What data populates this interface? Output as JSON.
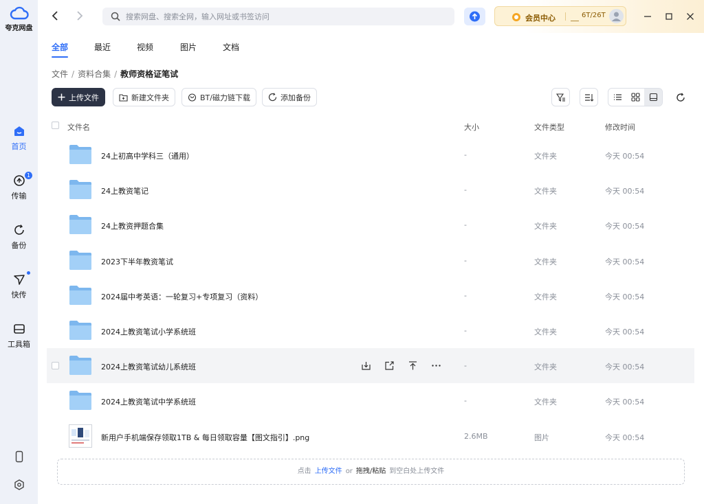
{
  "app": {
    "name": "夸克网盘"
  },
  "sidebar": {
    "items": [
      {
        "label": "首页",
        "icon": "home-icon",
        "active": true
      },
      {
        "label": "传输",
        "icon": "transfer-icon",
        "badge": "1"
      },
      {
        "label": "备份",
        "icon": "backup-icon"
      },
      {
        "label": "快传",
        "icon": "quick-send-icon",
        "dot": true
      },
      {
        "label": "工具箱",
        "icon": "toolbox-icon"
      }
    ],
    "bottom_icons": [
      "phone-icon",
      "settings-icon"
    ]
  },
  "topbar": {
    "search_placeholder": "搜索网盘、搜索全网，输入网址或书签访问",
    "vip_label": "会员中心",
    "quota": "6T/26T"
  },
  "tabs": [
    {
      "label": "全部",
      "active": true
    },
    {
      "label": "最近"
    },
    {
      "label": "视频"
    },
    {
      "label": "图片"
    },
    {
      "label": "文档"
    }
  ],
  "breadcrumb": {
    "items": [
      "文件",
      "资料合集"
    ],
    "current": "教师资格证笔试"
  },
  "toolbar": {
    "upload": "上传文件",
    "new_folder": "新建文件夹",
    "bt": "BT/磁力链下载",
    "backup": "添加备份"
  },
  "table": {
    "headers": {
      "name": "文件名",
      "size": "大小",
      "type": "文件类型",
      "modified": "修改时间"
    },
    "rows": [
      {
        "name": "24上初高中学科三（通用）",
        "size": "-",
        "type": "文件夹",
        "modified": "今天 00:54",
        "kind": "folder"
      },
      {
        "name": "24上教资笔记",
        "size": "-",
        "type": "文件夹",
        "modified": "今天 00:54",
        "kind": "folder"
      },
      {
        "name": "24上教资押题合集",
        "size": "-",
        "type": "文件夹",
        "modified": "今天 00:54",
        "kind": "folder"
      },
      {
        "name": "2023下半年教资笔试",
        "size": "-",
        "type": "文件夹",
        "modified": "今天 00:54",
        "kind": "folder"
      },
      {
        "name": "2024届中考英语：一轮复习+专项复习（资料）",
        "size": "-",
        "type": "文件夹",
        "modified": "今天 00:54",
        "kind": "folder"
      },
      {
        "name": "2024上教资笔试小学系统班",
        "size": "-",
        "type": "文件夹",
        "modified": "今天 00:54",
        "kind": "folder"
      },
      {
        "name": "2024上教资笔试幼儿系统班",
        "size": "-",
        "type": "文件夹",
        "modified": "今天 00:54",
        "kind": "folder",
        "hover": true
      },
      {
        "name": "2024上教资笔试中学系统班",
        "size": "-",
        "type": "文件夹",
        "modified": "今天 00:54",
        "kind": "folder"
      },
      {
        "name": "新用户手机端保存领取1TB & 每日领取容量【图文指引】.png",
        "size": "2.6MB",
        "type": "图片",
        "modified": "今天 00:54",
        "kind": "image"
      }
    ],
    "row_actions": [
      "download-icon",
      "share-icon",
      "move-to-top-icon",
      "more-icon"
    ]
  },
  "dropzone": {
    "prefix": "点击",
    "link": "上传文件",
    "or": "or",
    "drag": "拖拽/粘贴",
    "suffix": "到空白处上传文件"
  },
  "colors": {
    "accent": "#2f6ef7",
    "folder": "#8cc2f2",
    "primary_button": "#2c3345"
  }
}
